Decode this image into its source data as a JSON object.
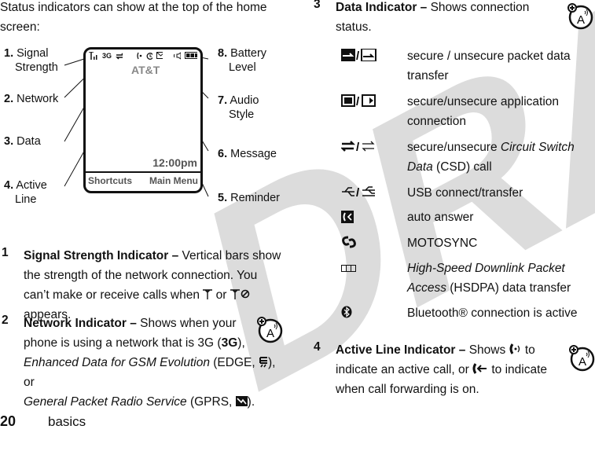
{
  "watermark": "DRAFT",
  "intro": "Status indicators can show at the top of the home screen:",
  "diagram": {
    "labels": {
      "l1_num": "1.",
      "l1_text_a": "Signal",
      "l1_text_b": "Strength",
      "l2_num": "2.",
      "l2_text": "Network",
      "l3_num": "3.",
      "l3_text": "Data",
      "l4_num": "4.",
      "l4_text_a": "Active",
      "l4_text_b": "Line",
      "l5_num": "5.",
      "l5_text": "Reminder",
      "l6_num": "6.",
      "l6_text": "Message",
      "l7_num": "7.",
      "l7_text_a": "Audio",
      "l7_text_b": "Style",
      "l8_num": "8.",
      "l8_text_a": "Battery",
      "l8_text_b": "Level"
    },
    "phone": {
      "status_icons": [
        "signal-icon",
        "3g-icon",
        "data-icon",
        "active-line-icon",
        "reminder-icon",
        "message-icon",
        "audio-style-icon",
        "battery-icon"
      ],
      "network": "3G",
      "carrier": "AT&T",
      "clock": "12:00pm",
      "soft_left": "Shortcuts",
      "soft_right": "Main Menu"
    }
  },
  "items": [
    {
      "num": "1",
      "title": "Signal Strength Indicator –",
      "text_a": " Vertical bars show the strength of the network connection. You can’t make or receive calls when ",
      "icon_a": "no-signal-icon",
      "text_b": " or ",
      "icon_b": "no-service-icon",
      "text_c": " appears."
    },
    {
      "num": "2",
      "title": "Network Indicator –",
      "line1": " Shows when your",
      "line2a": "phone is using a network that is 3G (",
      "icon_3g": "3G",
      "line2b": "),",
      "line3_italic": "Enhanced Data for GSM Evolution",
      "line3b": " (EDGE, ",
      "line3c": "), or",
      "line4_italic": "General Packet Radio Service",
      "line4b": " (GPRS, ",
      "line4c": ")."
    },
    {
      "num": "3",
      "title": "Data Indicator –",
      "line1": " Shows connection",
      "line2": "status.",
      "rows": [
        {
          "icon": "packet-data-icon",
          "text_a": "secure / unsecure packet data",
          "text_b": "transfer"
        },
        {
          "icon": "app-connection-icon",
          "text_a": "secure/unsecure application",
          "text_b": "connection"
        },
        {
          "icon": "csd-icon",
          "text_a_plain": "secure/unsecure ",
          "text_a_italic": "Circuit Switch",
          "text_b_italic": "Data",
          "text_b_plain": " (CSD) call"
        },
        {
          "icon": "usb-icon",
          "text_a": "USB connect/transfer"
        },
        {
          "icon": "auto-answer-icon",
          "text_a": "auto answer"
        },
        {
          "icon": "motosync-icon",
          "text_a": "MOTOSYNC"
        },
        {
          "icon": "hsdpa-icon",
          "text_a_italic": "High-Speed Downlink Packet",
          "text_b_italic": "Access",
          "text_b_plain": " (HSDPA) data transfer"
        },
        {
          "icon": "bluetooth-icon",
          "text_a": "Bluetooth® connection is active"
        }
      ]
    },
    {
      "num": "4",
      "title": "Active Line Indicator –",
      "line1": " Shows ",
      "line1b": " to",
      "line2a": "indicate an active call, or ",
      "line2b": " to indicate",
      "line3": "when call forwarding is on."
    }
  ],
  "footer": {
    "page_number": "20",
    "section": "basics"
  }
}
